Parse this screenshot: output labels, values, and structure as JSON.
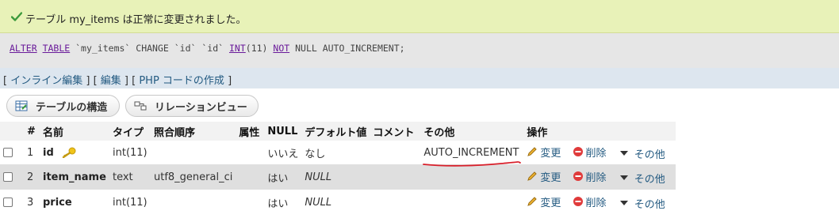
{
  "banner": {
    "message": "テーブル my_items は正常に変更されました。",
    "color": "#e8f2b8"
  },
  "sql": {
    "t1": "ALTER",
    "t2": " ",
    "t3": "TABLE",
    "t4": " `my_items` CHANGE `id` `id` ",
    "t5": "INT",
    "t6": "(11) ",
    "t7": "NOT",
    "t8": " NULL AUTO_INCREMENT;"
  },
  "links": {
    "open1": "[ ",
    "inline_edit": "インライン編集",
    "mid1": " ] [ ",
    "edit": "編集",
    "mid2": " ] [ ",
    "php_code": "PHP コードの作成",
    "close": " ]"
  },
  "buttons": {
    "structure": "テーブルの構造",
    "relation": "リレーションビュー"
  },
  "table": {
    "headers": [
      "#",
      "名前",
      "タイプ",
      "照合順序",
      "属性",
      "NULL",
      "デフォルト値",
      "コメント",
      "その他",
      "操作"
    ],
    "rows": [
      {
        "num": "1",
        "name": "id",
        "type": "int(11)",
        "collation": "",
        "attr": "",
        "null": "いいえ",
        "default": "なし",
        "comment": "",
        "extra": "AUTO_INCREMENT"
      },
      {
        "num": "2",
        "name": "item_name",
        "type": "text",
        "collation": "utf8_general_ci",
        "attr": "",
        "null": "はい",
        "default": "NULL",
        "comment": "",
        "extra": ""
      },
      {
        "num": "3",
        "name": "price",
        "type": "int(11)",
        "collation": "",
        "attr": "",
        "null": "はい",
        "default": "NULL",
        "comment": "",
        "extra": ""
      }
    ],
    "actions": {
      "change": "変更",
      "delete": "削除",
      "more": "その他"
    }
  },
  "icons": [
    "check-icon",
    "key-icon",
    "pencil-icon",
    "delete-icon",
    "dropdown-triangle-icon",
    "structure-icon",
    "relation-icon"
  ],
  "colors": {
    "link": "#235a81",
    "keyword": "#6a1b9a",
    "delete": "#e03b3b",
    "annotation": "#d81f2a"
  }
}
